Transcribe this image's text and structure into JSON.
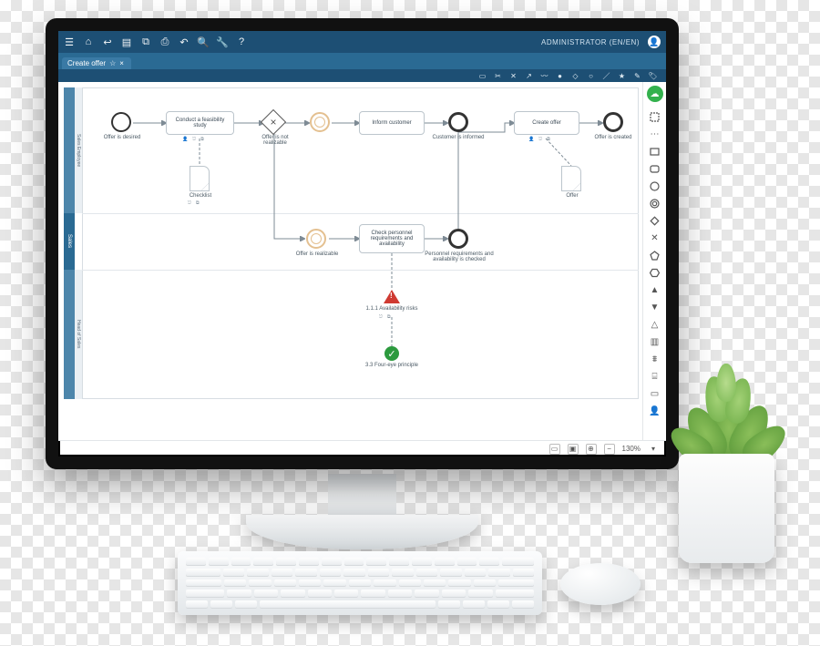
{
  "user": {
    "label": "ADMINISTRATOR (EN/EN)"
  },
  "tab": {
    "title": "Create offer",
    "star": "☆",
    "close": "×"
  },
  "toolbar_icons": [
    "menu",
    "home",
    "back",
    "file",
    "copy",
    "print",
    "undo",
    "search",
    "wrench",
    "help"
  ],
  "shapes_icons": [
    "rect",
    "cut",
    "x",
    "arrows",
    "curve",
    "dot",
    "gw",
    "circle",
    "line",
    "star",
    "pen",
    "tag"
  ],
  "palette": [
    "rect-sel",
    "rect",
    "rect-round",
    "circle",
    "ring",
    "diamond",
    "diamond-x",
    "pentagon",
    "hexagon",
    "triangle",
    "triangle-down",
    "triangle-alert",
    "bars",
    "chart",
    "db",
    "doc",
    "person"
  ],
  "lanes": {
    "pool": "Sales",
    "lane1": "Sales Employee",
    "lane2": "Head of Sales"
  },
  "nodes": {
    "start": "Offer is desired",
    "t1": "Conduct a feasibility study",
    "gw_label_top": "Offer is not realizable",
    "gw_label_bottom": "Offer is realizable",
    "t2": "Inform customer",
    "e2": "Customer is informed",
    "t3": "Create offer",
    "e3": "Offer is created",
    "doc1": "Checklist",
    "doc2": "Offer",
    "t4": "Check personnel requirements and availability",
    "e4": "Personnel requirements and availability is checked",
    "risk": "1.1.1 Availability risks",
    "control": "3.3 Four-eye principle"
  },
  "footer": {
    "zoom": "130%"
  }
}
